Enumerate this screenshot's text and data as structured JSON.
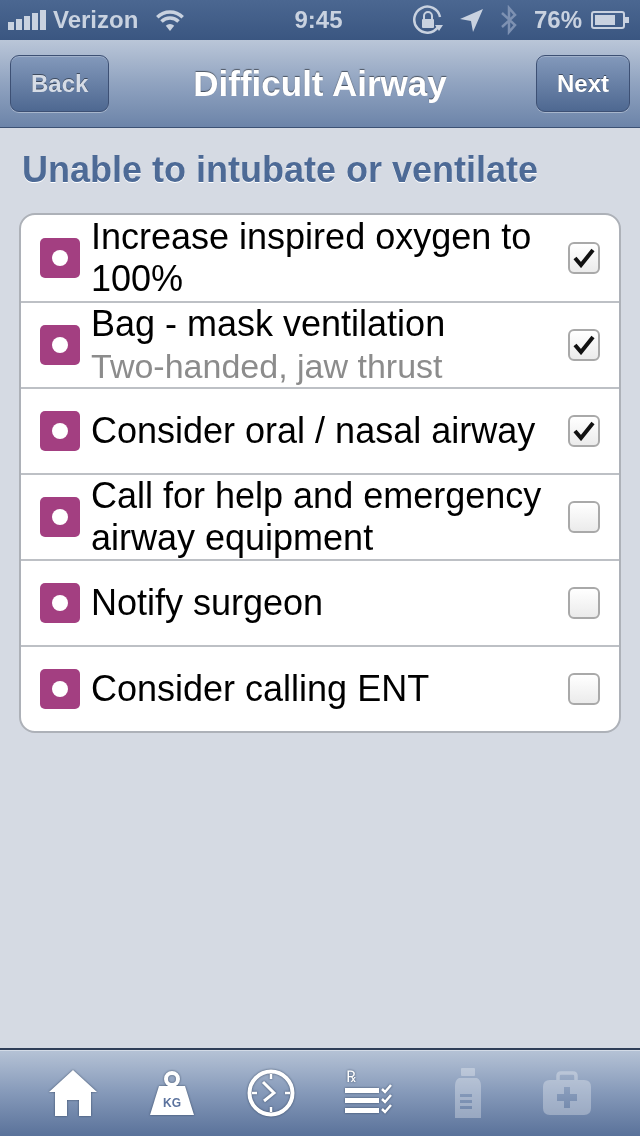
{
  "status_bar": {
    "carrier": "Verizon",
    "time": "9:45",
    "bluetooth_connected": false,
    "battery": "76%"
  },
  "nav_bar": {
    "back_button": "Back",
    "title": "Difficult Airway",
    "next_button": "Next"
  },
  "section": {
    "title": "Unable to intubate or ventilate",
    "items": [
      {
        "text": "Increase inspired oxygen to 100%",
        "checked": true
      },
      {
        "text": "Bag - mask ventilation",
        "note": "Two-handed, jaw thrust",
        "checked": true
      },
      {
        "text": "Consider oral / nasal airway",
        "checked": true
      },
      {
        "text": "Call for help and emergency airway equipment",
        "checked": false
      },
      {
        "text": "Notify surgeon",
        "checked": false
      },
      {
        "text": "Consider calling ENT",
        "checked": false
      }
    ]
  },
  "tab_bar": {
    "tabs": [
      {
        "kind": "home",
        "disabled": false
      },
      {
        "kind": "weight",
        "icon_text": "KG",
        "disabled": false
      },
      {
        "kind": "clock",
        "disabled": false
      },
      {
        "kind": "rx-list",
        "icon_text": "℞",
        "disabled": false
      },
      {
        "kind": "bottle",
        "disabled": true
      },
      {
        "kind": "medkit",
        "disabled": true
      }
    ]
  }
}
